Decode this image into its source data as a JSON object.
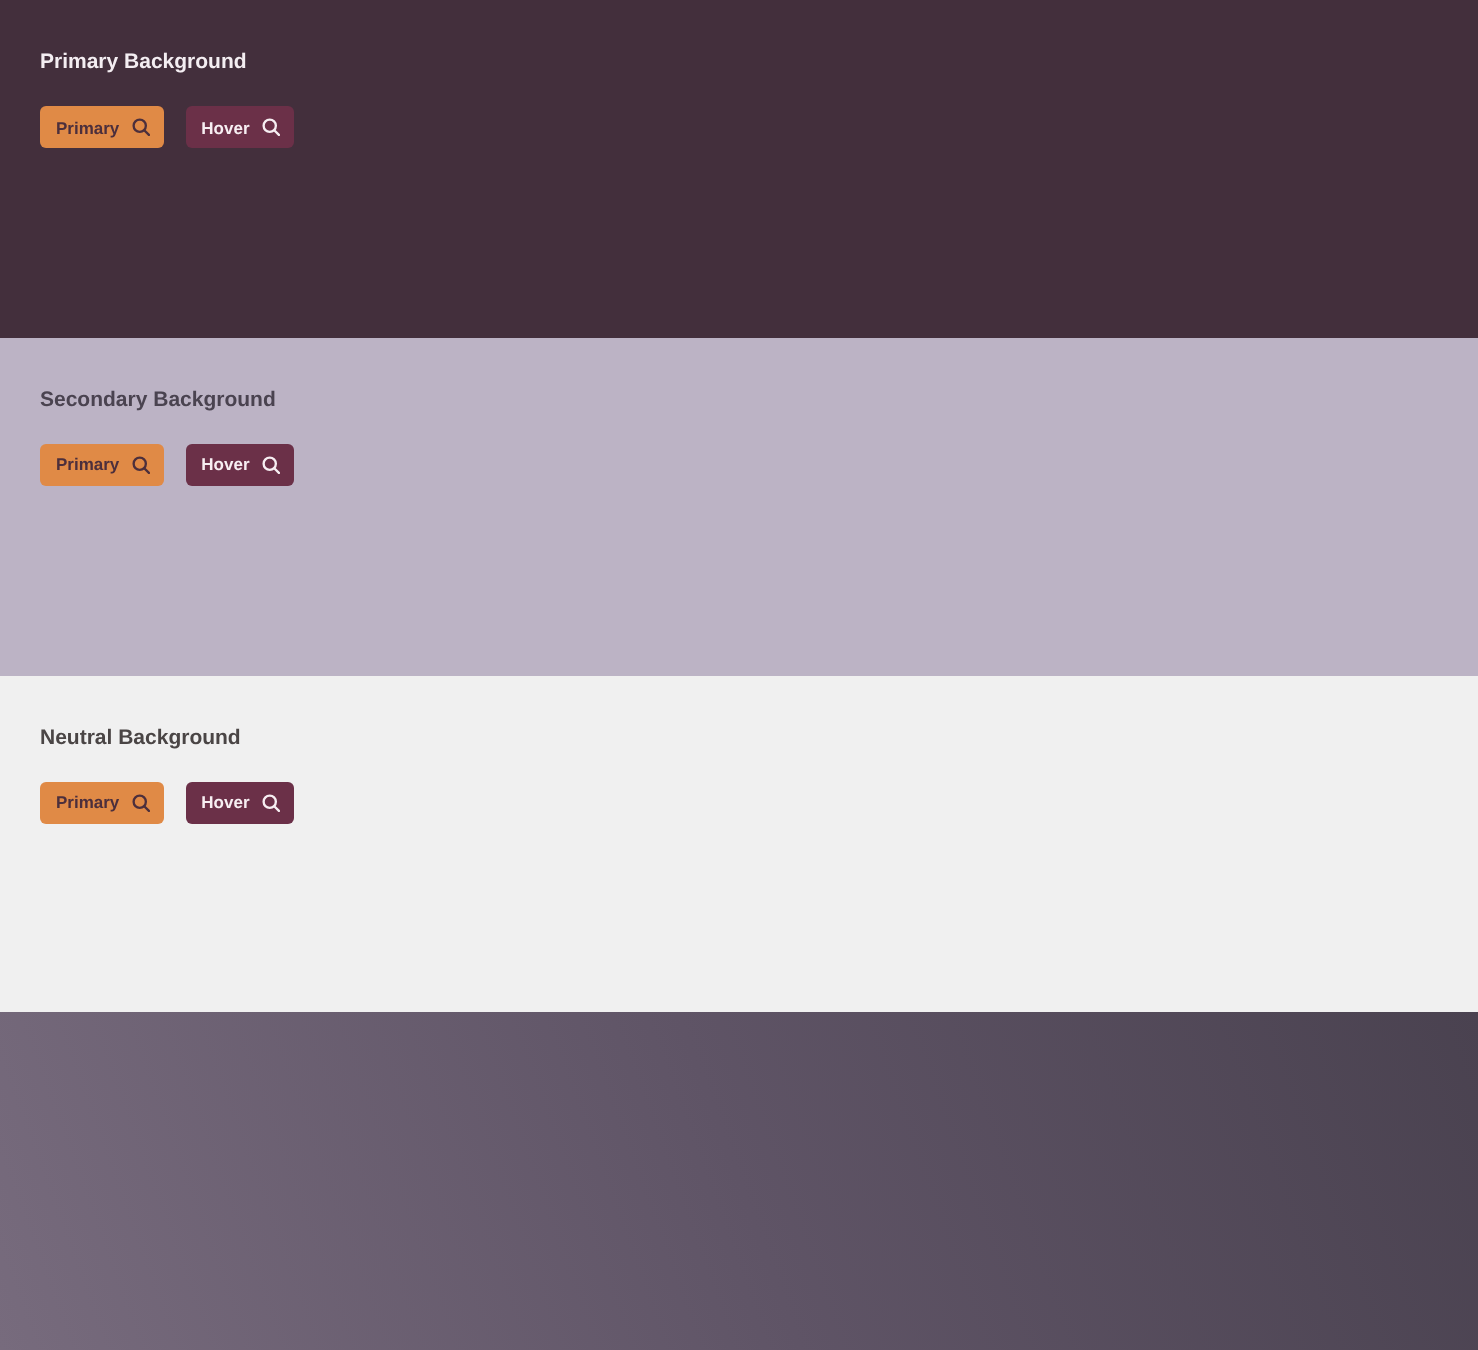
{
  "sections": [
    {
      "kind": "primary",
      "title": "Primary Background",
      "buttons": [
        {
          "kind": "primary",
          "label": "Primary"
        },
        {
          "kind": "hover",
          "label": "Hover"
        }
      ]
    },
    {
      "kind": "secondary",
      "title": "Secondary Background",
      "buttons": [
        {
          "kind": "primary",
          "label": "Primary"
        },
        {
          "kind": "hover",
          "label": "Hover"
        }
      ]
    },
    {
      "kind": "neutral",
      "title": "Neutral Background",
      "buttons": [
        {
          "kind": "primary",
          "label": "Primary"
        },
        {
          "kind": "hover",
          "label": "Hover"
        }
      ]
    },
    {
      "kind": "gradient"
    }
  ]
}
